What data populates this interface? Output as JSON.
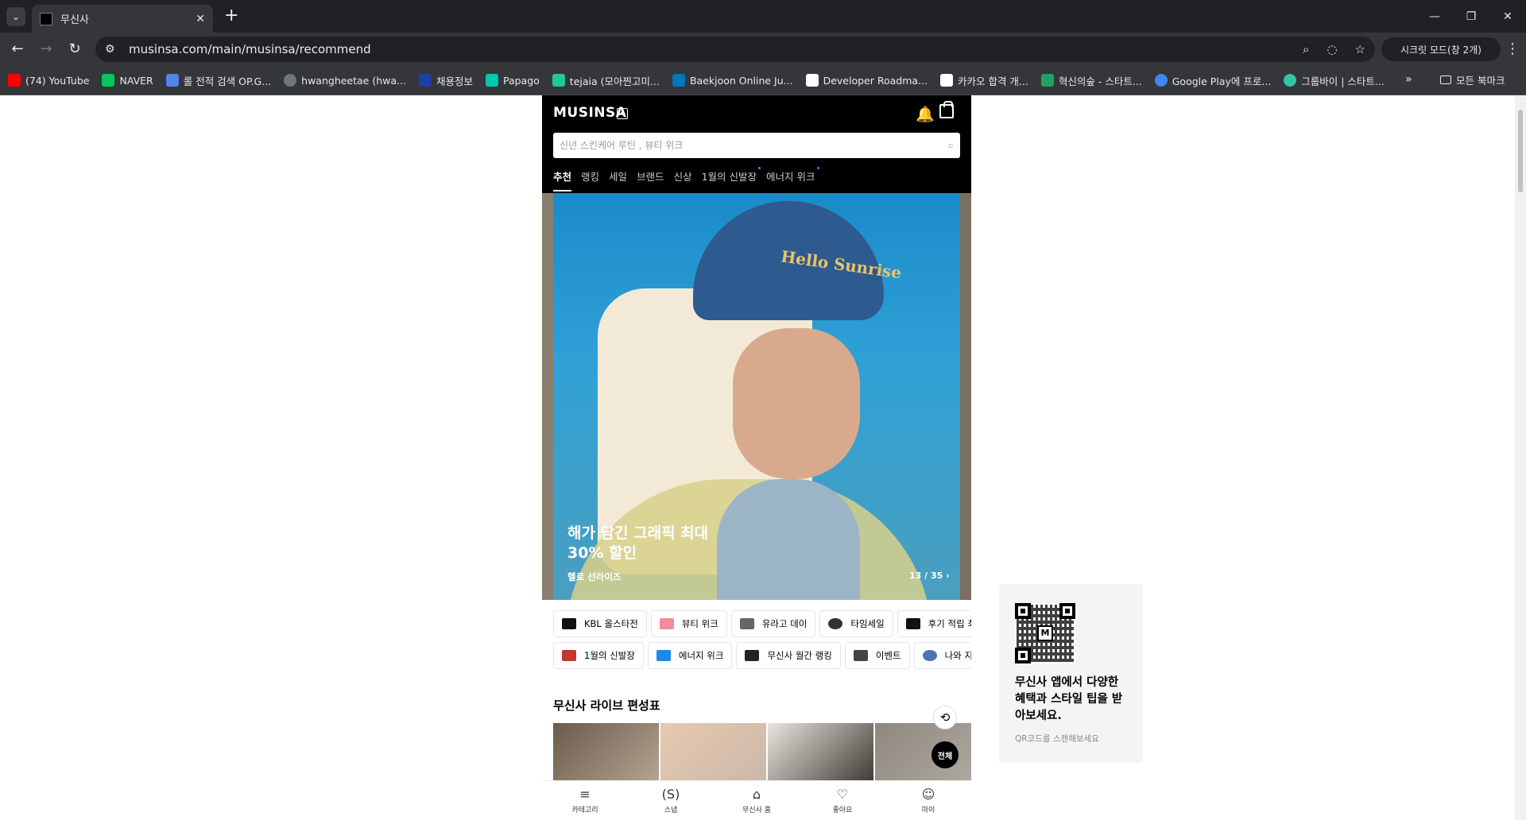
{
  "browser": {
    "tab_title": "무신사",
    "url": "musinsa.com/main/musinsa/recommend",
    "incognito_label": "시크릿 모드(창 2개)",
    "bookmarks": [
      {
        "label": "(74) YouTube",
        "color": "#ff0000"
      },
      {
        "label": "NAVER",
        "color": "#03c75a"
      },
      {
        "label": "롤 전적 검색 OP.G...",
        "color": "#5383e8"
      },
      {
        "label": "hwangheetae (hwa...",
        "color": "#6e7681"
      },
      {
        "label": "채용정보",
        "color": "#1f3fa8"
      },
      {
        "label": "Papago",
        "color": "#00c7ae"
      },
      {
        "label": "tejaia (모아찐고미...",
        "color": "#20c997"
      },
      {
        "label": "Baekjoon Online Ju...",
        "color": "#0076c0"
      },
      {
        "label": "Developer Roadma...",
        "color": "#ffffff"
      },
      {
        "label": "카카오 합격 개...",
        "color": "#ffffff"
      },
      {
        "label": "혁신의숲 - 스타트...",
        "color": "#1ea362"
      },
      {
        "label": "Google Play에 프로...",
        "color": "#4285f4"
      },
      {
        "label": "그룹바이 | 스타트...",
        "color": "#34c3a6"
      }
    ],
    "all_bookmarks": "모든 북마크"
  },
  "header": {
    "logo": "MUSINSA",
    "search_placeholder": "신년 스킨케어 루틴 , 뷰티 위크",
    "tabs": [
      {
        "label": "추천",
        "active": true,
        "dot": false
      },
      {
        "label": "랭킹",
        "active": false,
        "dot": false
      },
      {
        "label": "세일",
        "active": false,
        "dot": false
      },
      {
        "label": "브랜드",
        "active": false,
        "dot": false
      },
      {
        "label": "신상",
        "active": false,
        "dot": false
      },
      {
        "label": "1월의 신발장",
        "active": false,
        "dot": true
      },
      {
        "label": "에너지 위크",
        "active": false,
        "dot": true
      }
    ]
  },
  "banner": {
    "cap_text": "Hello Sunrise",
    "title": "해가 담긴 그래픽 최대 30% 할인",
    "subtitle": "헬로 선라이즈",
    "counter": "13 / 35 ›"
  },
  "chips": {
    "row1": [
      {
        "label": "KBL 올스타전",
        "color": "#111111"
      },
      {
        "label": "뷰티 위크",
        "color": "#f28b9a"
      },
      {
        "label": "유라고 데이",
        "color": "#666666"
      },
      {
        "label": "타임세일",
        "color": "#333333"
      },
      {
        "label": "후기 적립 최대",
        "color": "#111111"
      }
    ],
    "row2": [
      {
        "label": "1월의 신발장",
        "color": "#c0392b"
      },
      {
        "label": "에너지 위크",
        "color": "#1e88e5"
      },
      {
        "label": "무신사 월간 랭킹",
        "color": "#222222"
      },
      {
        "label": "이벤트",
        "color": "#444444"
      },
      {
        "label": "나와 지구를",
        "color": "#4a74b5"
      }
    ]
  },
  "section": {
    "title": "무신사 라이브 편성표",
    "all_label": "전체"
  },
  "bottom_nav": [
    {
      "label": "카테고리",
      "icon": "category-search-icon",
      "glyph": "≡"
    },
    {
      "label": "스냅",
      "icon": "snap-icon",
      "glyph": "(S)"
    },
    {
      "label": "무신사 홈",
      "icon": "home-icon",
      "glyph": "⌂"
    },
    {
      "label": "좋아요",
      "icon": "heart-icon",
      "glyph": "♡"
    },
    {
      "label": "마이",
      "icon": "person-icon",
      "glyph": "☺"
    }
  ],
  "qr_card": {
    "title": "무신사 앱에서 다양한 혜택과 스타일 팁을 받아보세요.",
    "subtitle": "QR코드를 스캔해보세요"
  }
}
